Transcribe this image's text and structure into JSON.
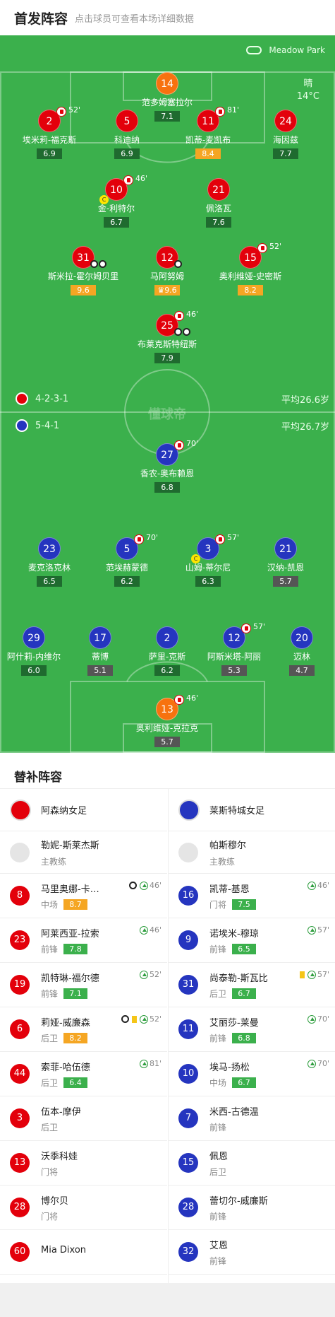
{
  "header": {
    "title": "首发阵容",
    "subtitle": "点击球员可查看本场详细数据"
  },
  "match": {
    "venue": "Meadow Park",
    "weather": "晴",
    "temp": "14°C"
  },
  "home": {
    "formation": "4-2-3-1",
    "avg_age": "平均26.6岁",
    "color": "#e3000b"
  },
  "away": {
    "formation": "5-4-1",
    "avg_age": "平均26.7岁",
    "color": "#2535bf"
  },
  "watermark": "懂球帝",
  "home_players": [
    {
      "num": "14",
      "name": "范多姆塞拉尔",
      "rating": "7.1",
      "cls": "gk"
    },
    {
      "num": "2",
      "name": "埃米莉-福克斯",
      "rating": "6.9",
      "sub": "52'"
    },
    {
      "num": "5",
      "name": "科迪纳",
      "rating": "6.9"
    },
    {
      "num": "11",
      "name": "凯蒂-麦凯布",
      "rating": "8.4",
      "sub": "81'",
      "hi": true
    },
    {
      "num": "24",
      "name": "海因兹",
      "rating": "7.7"
    },
    {
      "num": "10",
      "name": "金-利特尔",
      "rating": "6.7",
      "sub": "46'",
      "captain": "C"
    },
    {
      "num": "21",
      "name": "佩洛瓦",
      "rating": "7.6"
    },
    {
      "num": "31",
      "name": "斯米拉-霍尔姆贝里",
      "rating": "9.6",
      "hi": true,
      "goals": 2
    },
    {
      "num": "12",
      "name": "马阿努姆",
      "rating": "9.6",
      "hi": true,
      "goals": 1,
      "crown": "♛"
    },
    {
      "num": "15",
      "name": "奥利维娅-史密斯",
      "rating": "8.2",
      "sub": "52'",
      "hi": true
    },
    {
      "num": "25",
      "name": "布莱克斯特纽斯",
      "rating": "7.9",
      "sub": "46'",
      "goals": 2
    }
  ],
  "away_players": [
    {
      "num": "27",
      "name": "香农-奥布赖恩",
      "rating": "6.8",
      "sub": "70'"
    },
    {
      "num": "23",
      "name": "麦克洛克林",
      "rating": "6.5"
    },
    {
      "num": "5",
      "name": "范埃赫蒙德",
      "rating": "6.2",
      "sub": "70'"
    },
    {
      "num": "3",
      "name": "山姆-蒂尔尼",
      "rating": "6.3",
      "sub": "57'",
      "captain": "C"
    },
    {
      "num": "21",
      "name": "汉纳-凯恩",
      "rating": "5.7",
      "lo": true
    },
    {
      "num": "29",
      "name": "阿什莉-内维尔",
      "rating": "6.0"
    },
    {
      "num": "17",
      "name": "蒂博",
      "rating": "5.1",
      "lo": true
    },
    {
      "num": "2",
      "name": "萨里-克斯",
      "rating": "6.2"
    },
    {
      "num": "12",
      "name": "阿斯米塔-阿丽",
      "rating": "5.3",
      "sub": "57'",
      "lo": true
    },
    {
      "num": "20",
      "name": "迈林",
      "rating": "4.7",
      "lo": true
    },
    {
      "num": "13",
      "name": "奥利维娅-克拉克",
      "rating": "5.7",
      "sub": "46'",
      "cls": "gk",
      "lo": true
    }
  ],
  "bench": {
    "title": "替补阵容",
    "home_team": "阿森纳女足",
    "away_team": "莱斯特城女足",
    "home_coach": {
      "name": "勒妮-斯莱杰斯",
      "role": "主教练"
    },
    "away_coach": {
      "name": "帕斯穆尔",
      "role": "主教练"
    },
    "home": [
      {
        "num": "8",
        "name": "马里奥娜-卡…",
        "pos": "中场",
        "rating": "8.7",
        "hi": true,
        "ev": "46'",
        "goal": true
      },
      {
        "num": "23",
        "name": "阿莱西亚-拉索",
        "pos": "前锋",
        "rating": "7.8",
        "ev": "46'"
      },
      {
        "num": "19",
        "name": "凯特琳-福尔德",
        "pos": "前锋",
        "rating": "7.1",
        "ev": "52'"
      },
      {
        "num": "6",
        "name": "莉娅-威廉森",
        "pos": "后卫",
        "rating": "8.2",
        "hi": true,
        "ev": "52'",
        "goal": true,
        "yc": true
      },
      {
        "num": "44",
        "name": "索菲-哈伍德",
        "pos": "后卫",
        "rating": "6.4",
        "ev": "81'"
      },
      {
        "num": "3",
        "name": "伍本-摩伊",
        "pos": "后卫"
      },
      {
        "num": "13",
        "name": "沃季科娃",
        "pos": "门将"
      },
      {
        "num": "28",
        "name": "博尔贝",
        "pos": "门将"
      },
      {
        "num": "60",
        "name": "Mia Dixon",
        "pos": ""
      }
    ],
    "away": [
      {
        "num": "16",
        "name": "凯蒂-基恩",
        "pos": "门将",
        "rating": "7.5",
        "ev": "46'"
      },
      {
        "num": "9",
        "name": "诺埃米-穆琼",
        "pos": "前锋",
        "rating": "6.5",
        "ev": "57'"
      },
      {
        "num": "31",
        "name": "尚泰勒-斯瓦比",
        "pos": "后卫",
        "rating": "6.7",
        "ev": "57'",
        "yc": true
      },
      {
        "num": "11",
        "name": "艾丽莎-莱曼",
        "pos": "前锋",
        "rating": "6.8",
        "ev": "70'"
      },
      {
        "num": "10",
        "name": "埃马-扬松",
        "pos": "中场",
        "rating": "6.7",
        "ev": "70'"
      },
      {
        "num": "7",
        "name": "米西-古德温",
        "pos": "前锋"
      },
      {
        "num": "15",
        "name": "佩恩",
        "pos": "后卫"
      },
      {
        "num": "28",
        "name": "蕾切尔-威廉斯",
        "pos": "前锋"
      },
      {
        "num": "32",
        "name": "艾恩",
        "pos": "前锋"
      }
    ]
  }
}
